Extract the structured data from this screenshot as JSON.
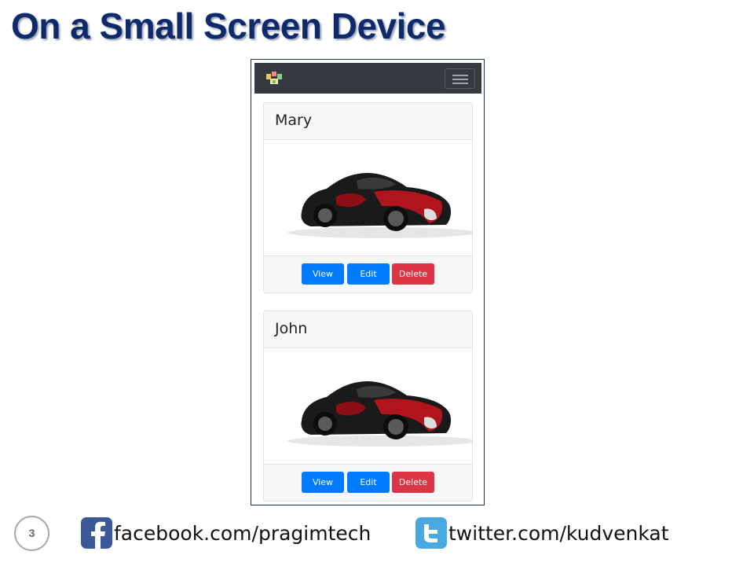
{
  "slide": {
    "title": "On a Small Screen Device",
    "number": "3"
  },
  "navbar": {
    "logo_icon": "brand-logo-icon",
    "toggler_icon": "hamburger-menu-icon",
    "background": "#343a40"
  },
  "cards": [
    {
      "name": "Mary",
      "image": "car-image",
      "buttons": {
        "view": "View",
        "edit": "Edit",
        "delete": "Delete"
      }
    },
    {
      "name": "John",
      "image": "car-image",
      "buttons": {
        "view": "View",
        "edit": "Edit",
        "delete": "Delete"
      }
    }
  ],
  "footer": {
    "facebook": "facebook.com/pragimtech",
    "twitter": "twitter.com/kudvenkat"
  },
  "colors": {
    "title": "#0e2a6b",
    "primary_button": "#007bff",
    "danger_button": "#dc3545",
    "facebook": "#3b5998",
    "twitter": "#4aa8e0"
  }
}
